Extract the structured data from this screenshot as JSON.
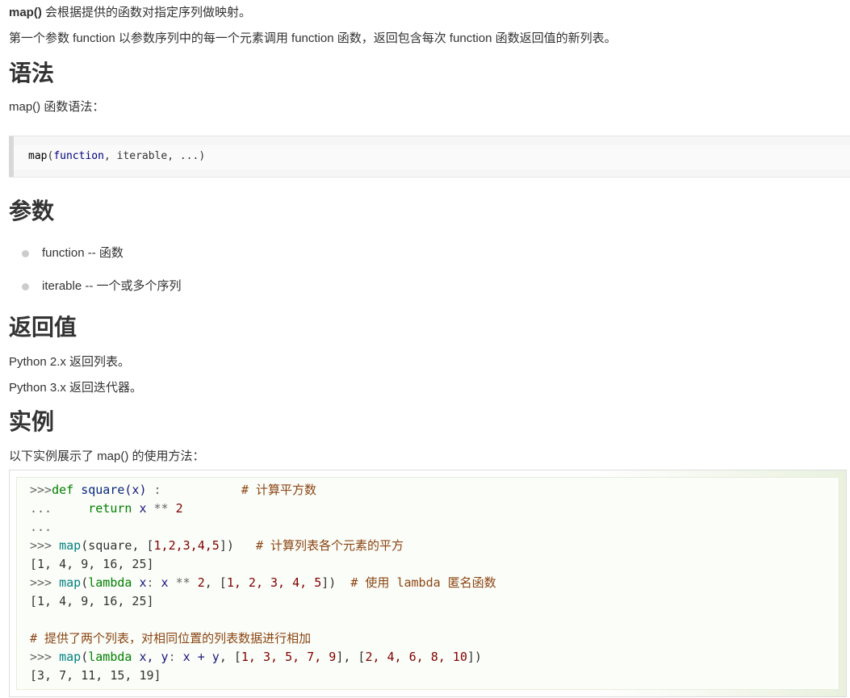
{
  "intro": {
    "title_strong": "map()",
    "title_rest": " 会根据提供的函数对指定序列做映射。",
    "description": "第一个参数 function 以参数序列中的每一个元素调用 function 函数，返回包含每次 function 函数返回值的新列表。"
  },
  "syntax": {
    "heading": "语法",
    "intro": "map() 函数语法：",
    "code_fn": "map",
    "code_open": "(",
    "code_arg1": "function",
    "code_rest": ", iterable, ...)"
  },
  "params": {
    "heading": "参数",
    "items": [
      "function -- 函数",
      "iterable -- 一个或多个序列"
    ]
  },
  "returns": {
    "heading": "返回值",
    "lines": [
      "Python 2.x 返回列表。",
      "Python 3.x 返回迭代器。"
    ]
  },
  "example": {
    "heading": "实例",
    "intro": "以下实例展示了 map() 的使用方法：",
    "code": {
      "l1_prompt": ">>>",
      "l1_kw": "def",
      "l1_fn": " square",
      "l1_args": "(x)",
      "l1_colon": " :",
      "l1_comment": "           # 计算平方数",
      "l2_prompt": "...",
      "l2_kw": "     return",
      "l2_rest_var": " x",
      "l2_op": " **",
      "l2_num": " 2",
      "l3_prompt": "...",
      "l4_prompt": ">>>",
      "l4_fn": " map",
      "l4_open": "(square, [",
      "l4_nums": "1,2,3,4,5",
      "l4_close": "])",
      "l4_comment": "   # 计算列表各个元素的平方",
      "l5": "[1, 4, 9, 16, 25]",
      "l6_prompt": ">>>",
      "l6_fn": " map",
      "l6_open": "(",
      "l6_lambda": "lambda",
      "l6_x": " x",
      "l6_colon": ":",
      "l6_x2": " x",
      "l6_op": " **",
      "l6_two": " 2",
      "l6_comma": ", [",
      "l6_nums": "1, 2, 3, 4, 5",
      "l6_close": "])",
      "l6_comment": "  # 使用 lambda 匿名函数",
      "l7": "[1, 4, 9, 16, 25]",
      "l9_comment": "# 提供了两个列表，对相同位置的列表数据进行相加",
      "l10_prompt": ">>>",
      "l10_fn": " map",
      "l10_open": "(",
      "l10_lambda": "lambda",
      "l10_xy": " x, y",
      "l10_colon": ":",
      "l10_expr": " x + y",
      "l10_comma": ", [",
      "l10_nums1": "1, 3, 5, 7, 9",
      "l10_mid": "], [",
      "l10_nums2": "2, 4, 6, 8, 10",
      "l10_close": "])",
      "l11": "[3, 7, 11, 15, 19]"
    }
  }
}
